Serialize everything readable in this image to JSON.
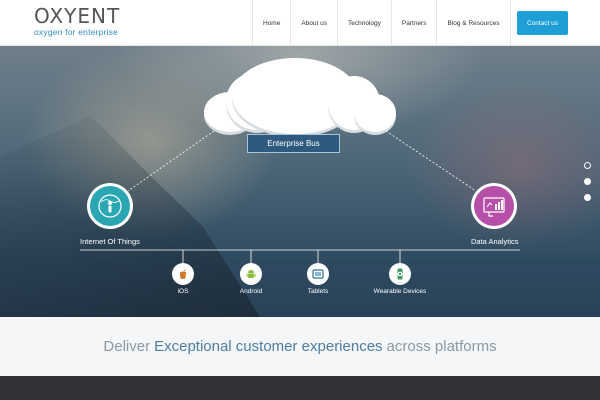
{
  "header": {
    "logo_main": "OXYENT",
    "logo_sub": "oxygen for enterprise",
    "nav": [
      "Home",
      "About us",
      "Technology",
      "Partners",
      "Blog & Resources"
    ],
    "contact_label": "Contact us"
  },
  "hero": {
    "bus_label": "Enterprise Bus",
    "left_label": "Internet Of Things",
    "right_label": "Data Analytics",
    "platforms": [
      "iOS",
      "Android",
      "Tablets",
      "Wearable Devices"
    ],
    "slider_dots": 3,
    "active_dot": 1
  },
  "tagline": {
    "pre": "Deliver",
    "highlight": "Exceptional customer experiences",
    "post": "across platforms"
  },
  "colors": {
    "accent": "#1f9fd6",
    "iot": "#2aa7b2",
    "analytics": "#b64fa8",
    "bus": "#2d5a7e",
    "dark_band": "#323236"
  }
}
